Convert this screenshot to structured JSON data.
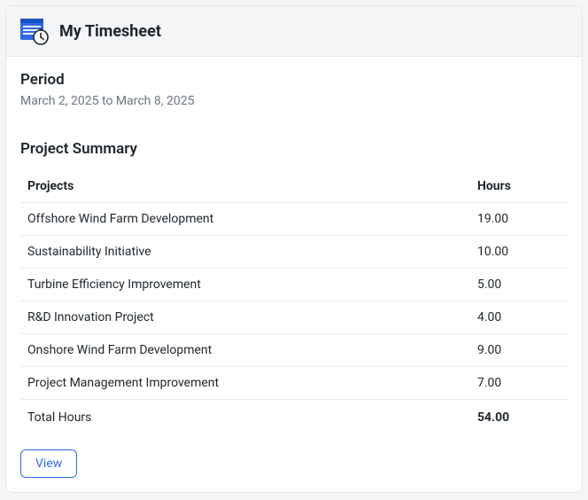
{
  "header": {
    "title": "My Timesheet",
    "icon": "timesheet-stopwatch-icon"
  },
  "period": {
    "label": "Period",
    "value": "March 2, 2025 to March 8, 2025"
  },
  "summary": {
    "heading": "Project Summary",
    "columns": {
      "project": "Projects",
      "hours": "Hours"
    },
    "rows": [
      {
        "project": "Offshore Wind Farm Development",
        "hours": "19.00"
      },
      {
        "project": "Sustainability Initiative",
        "hours": "10.00"
      },
      {
        "project": "Turbine Efficiency Improvement",
        "hours": "5.00"
      },
      {
        "project": "R&D Innovation Project",
        "hours": "4.00"
      },
      {
        "project": "Onshore Wind Farm Development",
        "hours": "9.00"
      },
      {
        "project": "Project Management Improvement",
        "hours": "7.00"
      }
    ],
    "total": {
      "label": "Total Hours",
      "hours": "54.00"
    }
  },
  "actions": {
    "view_label": "View"
  },
  "colors": {
    "accent": "#2e6ae6"
  }
}
